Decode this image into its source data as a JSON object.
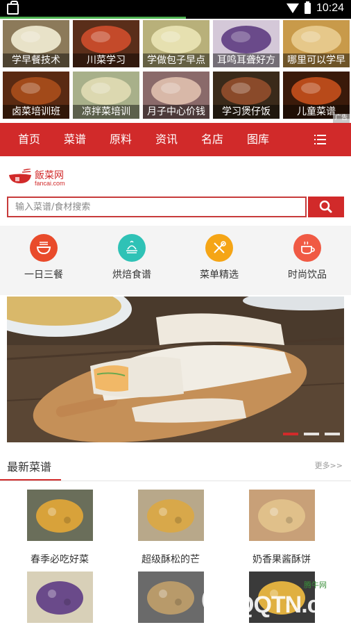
{
  "status_bar": {
    "time": "10:24",
    "load_progress": 0.53
  },
  "ads": {
    "items": [
      {
        "caption": "学早餐技术",
        "bg": "#8c7a5a",
        "fg": "#e8e2c8"
      },
      {
        "caption": "川菜学习",
        "bg": "#5a2e1a",
        "fg": "#c44a2a"
      },
      {
        "caption": "学做包子早点",
        "bg": "#b8b07a",
        "fg": "#e6e0b0"
      },
      {
        "caption": "耳鸣耳聋好方",
        "bg": "#d4c8d8",
        "fg": "#6a4a8a"
      },
      {
        "caption": "哪里可以学早",
        "bg": "#c89a4a",
        "fg": "#e6c88a"
      },
      {
        "caption": "卤菜培训班",
        "bg": "#5a2a12",
        "fg": "#a24a1a"
      },
      {
        "caption": "凉拌菜培训",
        "bg": "#a8b08a",
        "fg": "#dcd8b0"
      },
      {
        "caption": "月子中心价钱",
        "bg": "#8a6a6a",
        "fg": "#d8b8a8"
      },
      {
        "caption": "学习煲仔饭",
        "bg": "#3a2a1a",
        "fg": "#8a4a2a"
      },
      {
        "caption": "儿童菜谱",
        "bg": "#3a1a0a",
        "fg": "#b84a1a"
      }
    ],
    "ad_mark": "广告"
  },
  "nav": {
    "items": [
      "首页",
      "菜谱",
      "原料",
      "资讯",
      "名店",
      "图库"
    ],
    "menu_icon": "menu-icon"
  },
  "logo": {
    "title": "飯菜网",
    "domain": "fancai.com"
  },
  "search": {
    "placeholder": "输入菜谱/食材搜索",
    "button_icon": "search-icon"
  },
  "categories": [
    {
      "label": "一日三餐",
      "color": "#e94b2b",
      "icon": "noodle-bowl-icon"
    },
    {
      "label": "烘焙食谱",
      "color": "#2fc2b6",
      "icon": "baking-icon"
    },
    {
      "label": "菜单精选",
      "color": "#f5a516",
      "icon": "utensils-icon"
    },
    {
      "label": "时尚饮品",
      "color": "#f05a44",
      "icon": "coffee-cup-icon"
    }
  ],
  "banner": {
    "slides": 3,
    "active_slide": 1
  },
  "latest": {
    "title": "最新菜谱",
    "more": "更多>>",
    "recipes": [
      {
        "name": "春季必吃好菜",
        "bg": "#6a6e5a",
        "fg": "#d8a23a"
      },
      {
        "name": "超级酥松的芒",
        "bg": "#b8a88a",
        "fg": "#d8a84a"
      },
      {
        "name": "奶香果酱酥饼",
        "bg": "#c8a078",
        "fg": "#e0c08a"
      },
      {
        "name": "",
        "bg": "#d8d0b8",
        "fg": "#6a4a8a"
      },
      {
        "name": "",
        "bg": "#6a6a6a",
        "fg": "#b89a6a"
      },
      {
        "name": "",
        "bg": "#3a3a3a",
        "fg": "#e0b040"
      }
    ]
  },
  "watermark": {
    "text": "QQTN.com",
    "brand": "腾牛网"
  },
  "colors": {
    "brand_red": "#d12a2a",
    "search_border": "#c73a3a"
  }
}
